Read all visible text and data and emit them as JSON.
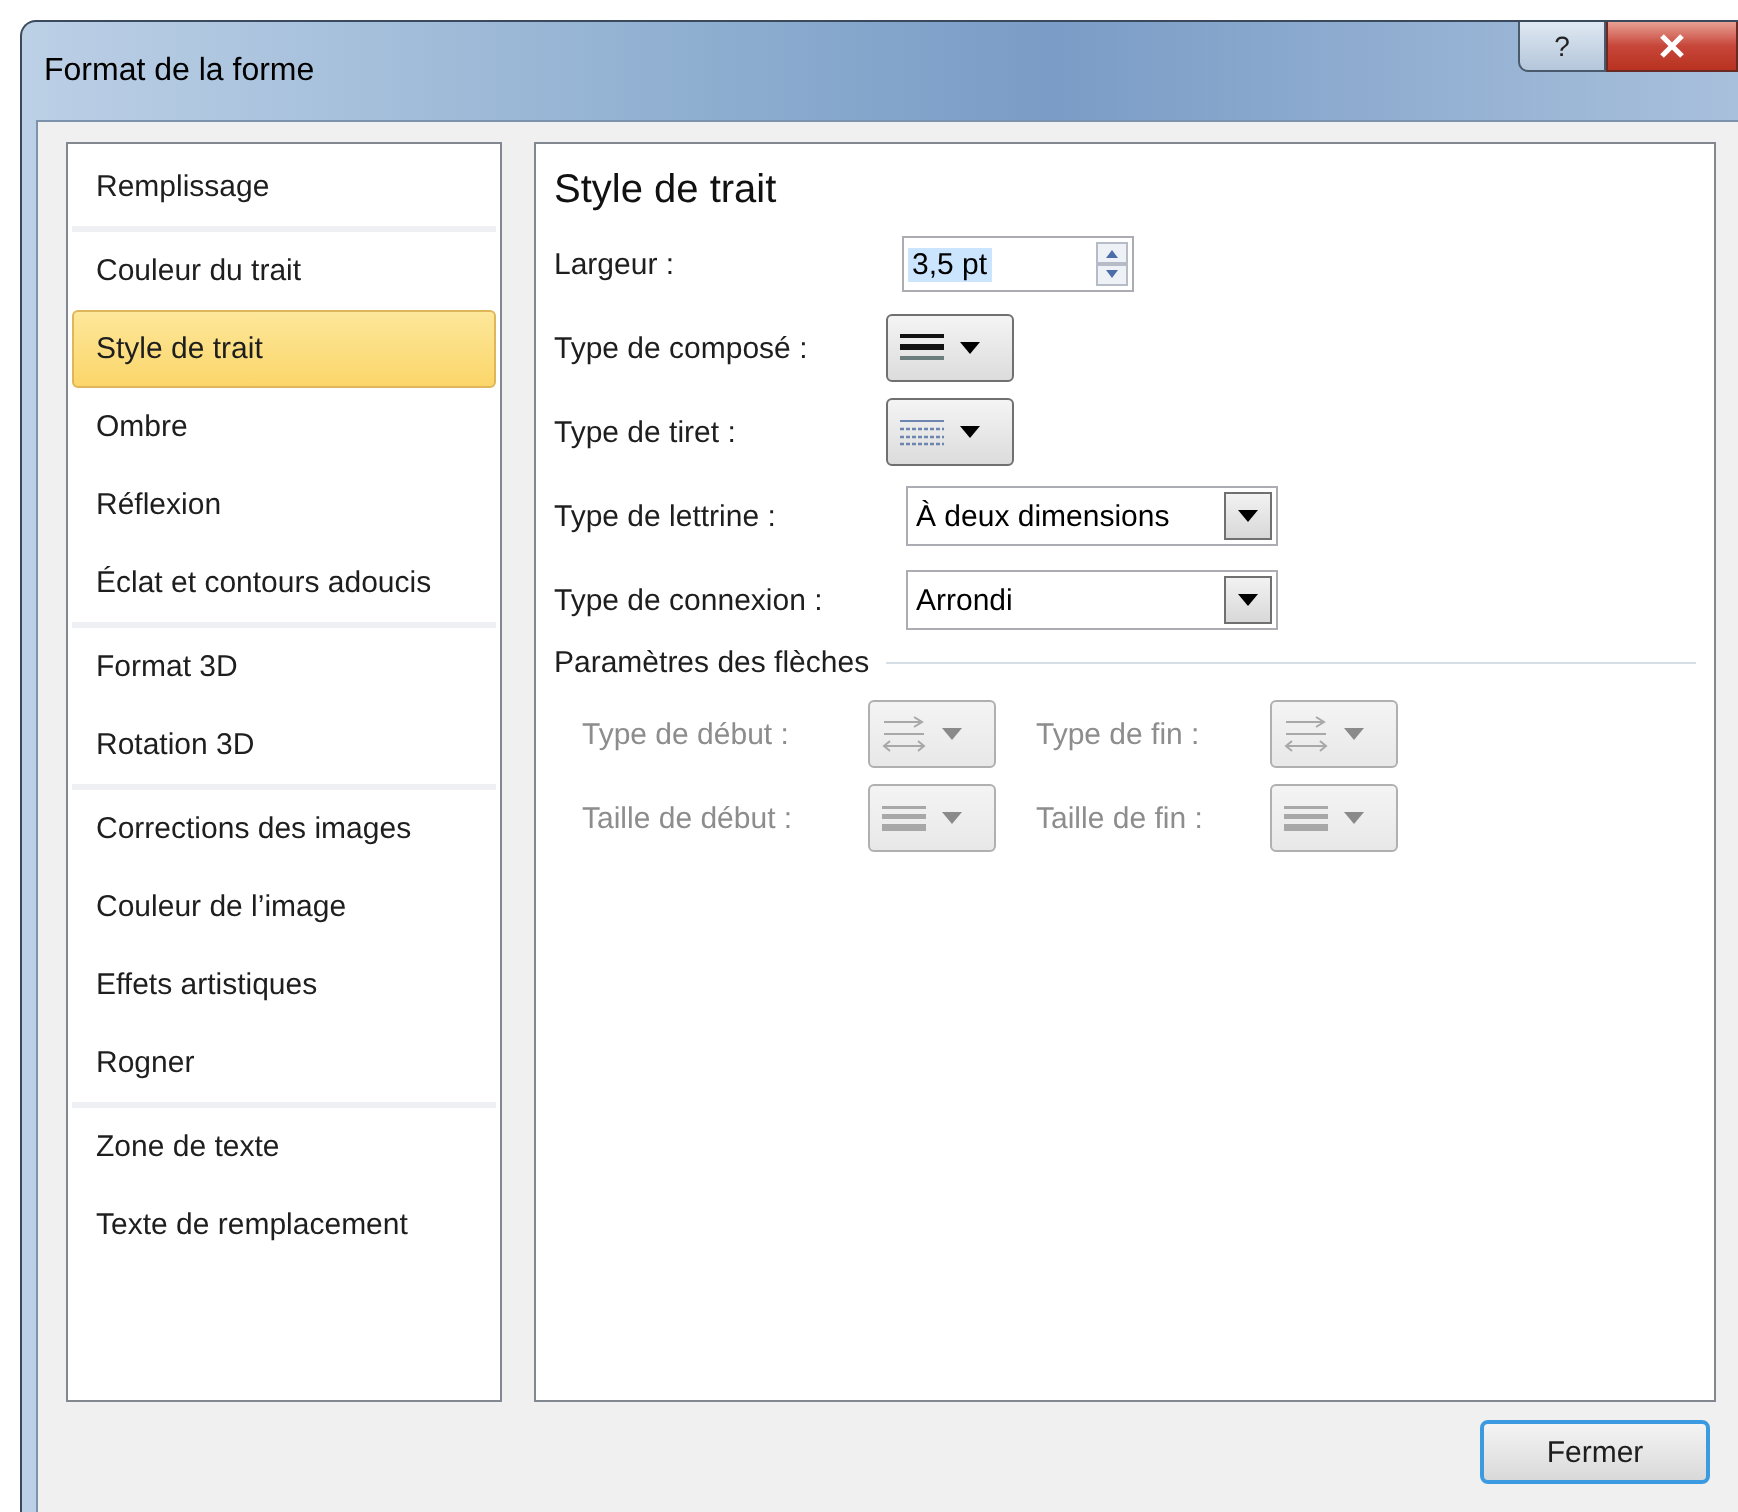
{
  "window": {
    "title": "Format de la forme",
    "help_label": "?"
  },
  "sidebar": {
    "groups": [
      {
        "items": [
          {
            "label": "Remplissage",
            "selected": false
          }
        ]
      },
      {
        "items": [
          {
            "label": "Couleur du trait",
            "selected": false
          },
          {
            "label": "Style de trait",
            "selected": true
          },
          {
            "label": "Ombre",
            "selected": false
          },
          {
            "label": "Réflexion",
            "selected": false
          },
          {
            "label": "Éclat et contours adoucis",
            "selected": false
          }
        ]
      },
      {
        "items": [
          {
            "label": "Format 3D",
            "selected": false
          },
          {
            "label": "Rotation 3D",
            "selected": false
          }
        ]
      },
      {
        "items": [
          {
            "label": "Corrections des images",
            "selected": false
          },
          {
            "label": "Couleur de l’image",
            "selected": false
          },
          {
            "label": "Effets artistiques",
            "selected": false
          },
          {
            "label": "Rogner",
            "selected": false
          }
        ]
      },
      {
        "items": [
          {
            "label": "Zone de texte",
            "selected": false
          },
          {
            "label": "Texte de remplacement",
            "selected": false
          }
        ]
      }
    ]
  },
  "panel": {
    "heading": "Style de trait",
    "fields": [
      {
        "kind": "spin",
        "label": "Largeur :",
        "value": "3,5 pt",
        "text_selected": true
      },
      {
        "kind": "compound",
        "label": "Type de composé :"
      },
      {
        "kind": "dash",
        "label": "Type de tiret :"
      },
      {
        "kind": "dropdown",
        "label": "Type de lettrine :",
        "value": "À deux dimensions"
      },
      {
        "kind": "dropdown",
        "label": "Type de connexion :",
        "value": "Arrondi"
      }
    ],
    "arrows": {
      "title": "Paramètres des flèches",
      "fields": [
        {
          "kind": "arrow",
          "label": "Type de début :",
          "disabled": true
        },
        {
          "kind": "arrow",
          "label": "Type de fin :",
          "disabled": true
        },
        {
          "kind": "size",
          "label": "Taille de début :",
          "disabled": true
        },
        {
          "kind": "size",
          "label": "Taille de fin :",
          "disabled": true
        }
      ]
    }
  },
  "footer": {
    "close_button": "Fermer"
  }
}
